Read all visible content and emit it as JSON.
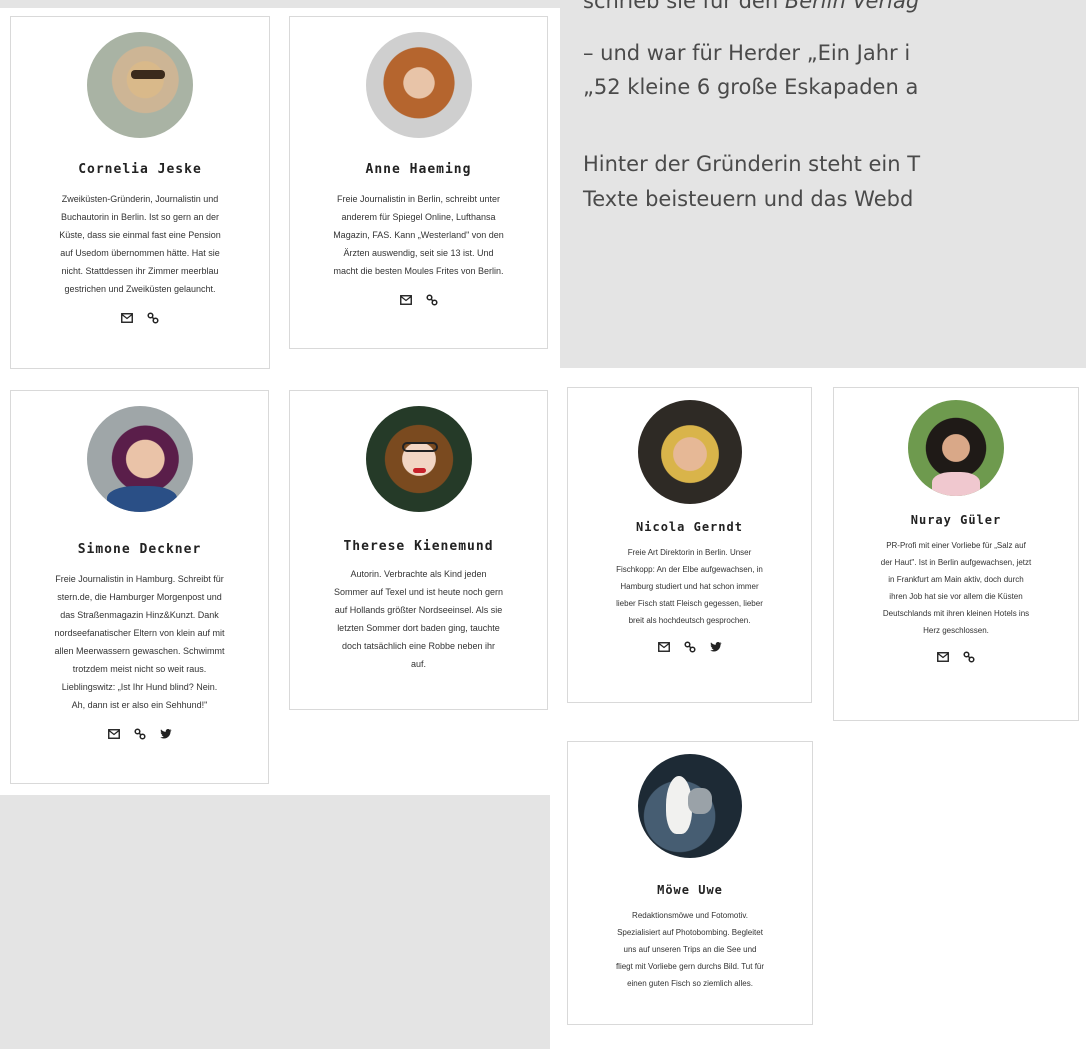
{
  "intro": {
    "line1_prefix": "schrieb sie für den ",
    "line1_italic": "Berlin Verlag",
    "line2": "– und war für Herder „Ein Jahr i",
    "line3": "„52 kleine 6 große Eskapaden a",
    "line4": "Hinter der Gründerin steht ein T",
    "line5": "Texte beisteuern und das Webd"
  },
  "cards": [
    {
      "name": "Cornelia Jeske",
      "bio": [
        "Zweiküsten-Gründerin, Journalistin und",
        "Buchautorin in Berlin. Ist so gern an der",
        "Küste, dass sie einmal fast eine Pension",
        "auf Usedom übernommen hätte. Hat sie",
        "nicht. Stattdessen ihr Zimmer meerblau",
        "gestrichen und Zweiküsten gelauncht."
      ],
      "icons": [
        "mail-icon",
        "link-icon"
      ]
    },
    {
      "name": "Anne Haeming",
      "bio": [
        "Freie Journalistin in Berlin, schreibt unter",
        "anderem für Spiegel Online, Lufthansa",
        "Magazin, FAS. Kann „Westerland\" von den",
        "Ärzten auswendig, seit sie 13 ist. Und",
        "macht die besten Moules Frites von Berlin."
      ],
      "icons": [
        "mail-icon",
        "link-icon"
      ]
    },
    {
      "name": "Simone Deckner",
      "bio": [
        "Freie Journalistin in Hamburg. Schreibt für",
        "stern.de, die Hamburger Morgenpost und",
        "das Straßenmagazin Hinz&Kunzt. Dank",
        "nordseefanatischer Eltern von klein auf mit",
        "allen Meerwassern gewaschen. Schwimmt",
        "trotzdem meist nicht so weit raus.",
        "Lieblingswitz: „Ist Ihr Hund blind? Nein.",
        "Ah, dann ist er also ein Sehhund!\""
      ],
      "icons": [
        "mail-icon",
        "link-icon",
        "twitter-icon"
      ]
    },
    {
      "name": "Therese Kienemund",
      "bio": [
        "Autorin. Verbrachte als Kind jeden",
        "Sommer auf Texel und ist heute noch gern",
        "auf Hollands größter Nordseeinsel. Als sie",
        "letzten Sommer dort baden ging, tauchte",
        "doch tatsächlich eine Robbe neben ihr",
        "auf."
      ],
      "icons": []
    },
    {
      "name": "Nicola Gerndt",
      "bio": [
        "Freie Art Direktorin in Berlin. Unser",
        "Fischkopp: An der Elbe aufgewachsen, in",
        "Hamburg studiert und hat schon immer",
        "lieber Fisch statt Fleisch gegessen, lieber",
        "breit als hochdeutsch gesprochen."
      ],
      "icons": [
        "mail-icon",
        "link-icon",
        "twitter-icon"
      ]
    },
    {
      "name": "Nuray Güler",
      "bio": [
        "PR-Profi mit einer Vorliebe für „Salz auf",
        "der Haut\". Ist in Berlin aufgewachsen, jetzt",
        "in Frankfurt am Main aktiv, doch durch",
        "ihren Job hat sie vor allem die Küsten",
        "Deutschlands mit ihren kleinen Hotels ins",
        "Herz geschlossen."
      ],
      "icons": [
        "mail-icon",
        "link-icon"
      ]
    },
    {
      "name": "Möwe Uwe",
      "bio": [
        "Redaktionsmöwe und Fotomotiv.",
        "Spezialisiert auf Photobombing. Begleitet",
        "uns auf unseren Trips an die See und",
        "fliegt mit Vorliebe gern durchs Bild. Tut für",
        "einen guten Fisch so ziemlich alles."
      ],
      "icons": []
    }
  ]
}
